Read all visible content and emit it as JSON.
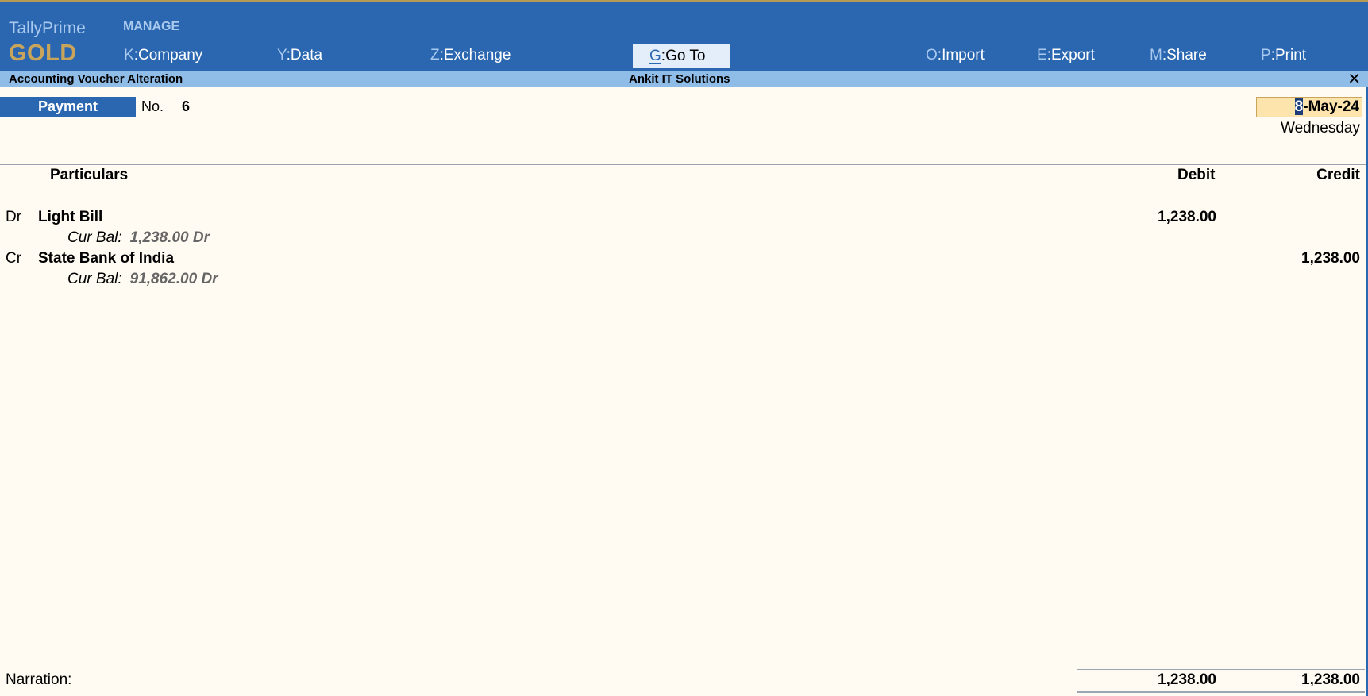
{
  "app": {
    "name": "TallyPrime",
    "edition": "GOLD"
  },
  "menu": {
    "section_label": "MANAGE",
    "items": [
      {
        "key": "K",
        "label": "Company"
      },
      {
        "key": "Y",
        "label": "Data"
      },
      {
        "key": "Z",
        "label": "Exchange"
      },
      {
        "key": "G",
        "label": "Go To"
      },
      {
        "key": "O",
        "label": "Import"
      },
      {
        "key": "E",
        "label": "Export"
      },
      {
        "key": "M",
        "label": "Share"
      },
      {
        "key": "P",
        "label": "Print"
      }
    ]
  },
  "screen": {
    "title": "Accounting Voucher Alteration",
    "company": "Ankit IT Solutions",
    "close_symbol": "✕"
  },
  "voucher": {
    "type": "Payment",
    "number_label": "No.",
    "number": "6",
    "date_caret": "8",
    "date_rest": "-May-24",
    "weekday": "Wednesday"
  },
  "columns": {
    "particulars": "Particulars",
    "debit": "Debit",
    "credit": "Credit"
  },
  "entries": [
    {
      "side": "Dr",
      "ledger": "Light Bill",
      "bal_label": "Cur Bal:",
      "bal_value": "1,238.00 Dr",
      "debit": "1,238.00",
      "credit": ""
    },
    {
      "side": "Cr",
      "ledger": "State Bank of India",
      "bal_label": "Cur Bal:",
      "bal_value": "91,862.00 Dr",
      "debit": "",
      "credit": "1,238.00"
    }
  ],
  "footer": {
    "narration_label": "Narration:",
    "total_debit": "1,238.00",
    "total_credit": "1,238.00"
  },
  "colors": {
    "topbar": "#2a67b0",
    "subbar": "#8fbde7",
    "brand_gold": "#c9a55c",
    "background": "#fffaf2",
    "date_highlight": "#fde4ac"
  }
}
